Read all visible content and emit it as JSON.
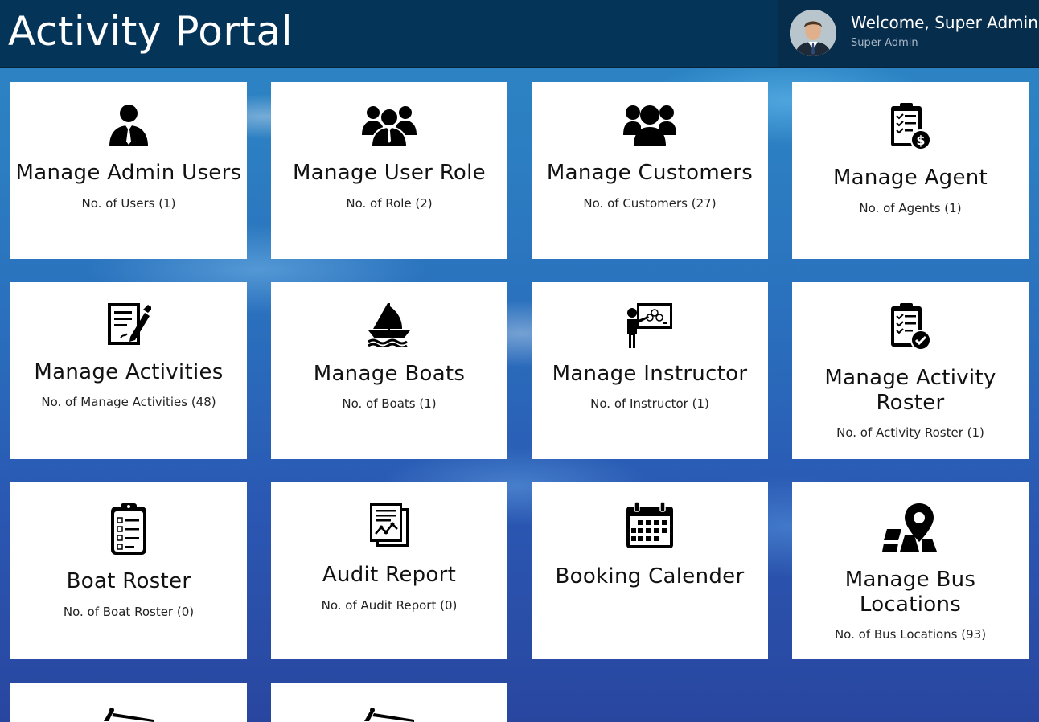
{
  "header": {
    "title": "Activity Portal",
    "welcome": "Welcome, Super Admin",
    "role": "Super Admin"
  },
  "tiles": [
    {
      "title": "Manage Admin Users",
      "count": "No. of Users (1)",
      "icon": "user-icon"
    },
    {
      "title": "Manage User Role",
      "count": "No. of Role (2)",
      "icon": "users-group-icon"
    },
    {
      "title": "Manage Customers",
      "count": "No. of Customers (27)",
      "icon": "customers-icon"
    },
    {
      "title": "Manage Agent",
      "count": "No. of Agents (1)",
      "icon": "clipboard-dollar-icon"
    },
    {
      "title": "Manage Activities",
      "count": "No. of Manage Activities (48)",
      "icon": "edit-document-icon"
    },
    {
      "title": "Manage Boats",
      "count": "No. of Boats (1)",
      "icon": "sailboat-icon"
    },
    {
      "title": "Manage Instructor",
      "count": "No. of Instructor (1)",
      "icon": "instructor-board-icon"
    },
    {
      "title": "Manage Activity Roster",
      "count": "No. of Activity Roster (1)",
      "icon": "clipboard-check-icon"
    },
    {
      "title": "Boat Roster",
      "count": "No. of Boat Roster (0)",
      "icon": "clipboard-checklist-icon"
    },
    {
      "title": "Audit Report",
      "count": "No. of Audit Report (0)",
      "icon": "report-chart-icon"
    },
    {
      "title": "Booking Calender",
      "count": "",
      "icon": "calendar-icon"
    },
    {
      "title": "Manage Bus Locations",
      "count": "No. of Bus Locations (93)",
      "icon": "map-pin-icon"
    }
  ],
  "colors": {
    "header_bg": "#053459",
    "tile_bg": "#ffffff"
  }
}
